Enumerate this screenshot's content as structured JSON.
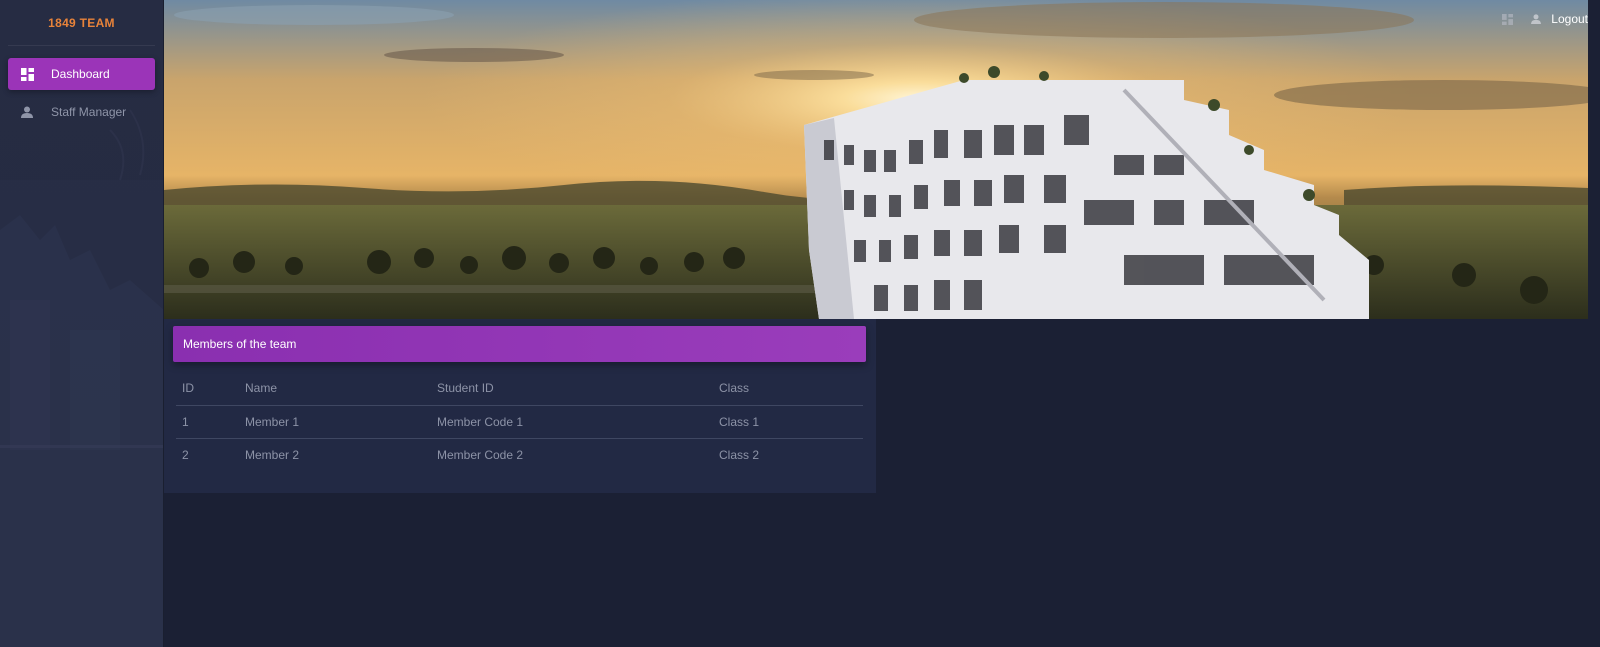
{
  "brand": "1849 TEAM",
  "sidebar": {
    "items": [
      {
        "label": "Dashboard",
        "icon": "dashboard-icon",
        "active": true
      },
      {
        "label": "Staff Manager",
        "icon": "person-icon",
        "active": false
      }
    ]
  },
  "topbar": {
    "logout_label": "Logout"
  },
  "card": {
    "title": "Members of the team",
    "columns": [
      "ID",
      "Name",
      "Student ID",
      "Class"
    ],
    "rows": [
      [
        "1",
        "Member 1",
        "Member Code 1",
        "Class 1"
      ],
      [
        "2",
        "Member 2",
        "Member Code 2",
        "Class 2"
      ]
    ]
  },
  "colors": {
    "accent": "#9b34b8",
    "brand": "#e8833a",
    "background": "#1b2034",
    "panel": "#222944"
  }
}
